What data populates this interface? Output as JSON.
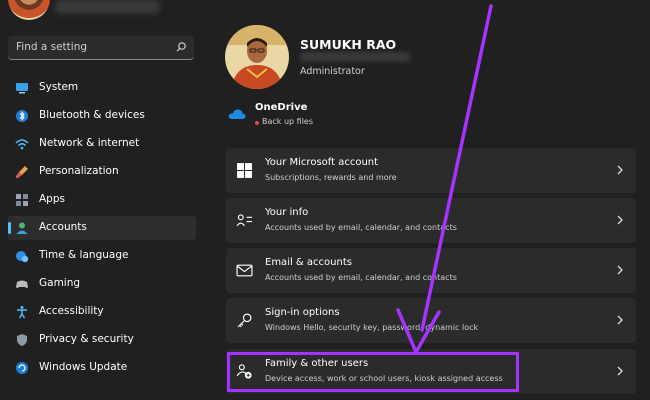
{
  "sidebar": {
    "search_placeholder": "Find a setting",
    "items": [
      {
        "label": "System",
        "icon": "monitor-icon"
      },
      {
        "label": "Bluetooth & devices",
        "icon": "bluetooth-icon"
      },
      {
        "label": "Network & internet",
        "icon": "wifi-icon"
      },
      {
        "label": "Personalization",
        "icon": "paintbrush-icon"
      },
      {
        "label": "Apps",
        "icon": "apps-icon"
      },
      {
        "label": "Accounts",
        "icon": "person-icon",
        "active": true
      },
      {
        "label": "Time & language",
        "icon": "globe-clock-icon"
      },
      {
        "label": "Gaming",
        "icon": "gamepad-icon"
      },
      {
        "label": "Accessibility",
        "icon": "accessibility-icon"
      },
      {
        "label": "Privacy & security",
        "icon": "shield-icon"
      },
      {
        "label": "Windows Update",
        "icon": "update-icon"
      }
    ]
  },
  "profile": {
    "name": "SUMUKH RAO",
    "role": "Administrator"
  },
  "onedrive": {
    "title": "OneDrive",
    "status": "Back up files"
  },
  "cards": [
    {
      "title": "Your Microsoft account",
      "subtitle": "Subscriptions, rewards and more",
      "icon": "windows-logo-icon"
    },
    {
      "title": "Your info",
      "subtitle": "Accounts used by email, calendar, and contacts",
      "icon": "contact-card-icon"
    },
    {
      "title": "Email & accounts",
      "subtitle": "Accounts used by email, calendar, and contacts",
      "icon": "envelope-icon"
    },
    {
      "title": "Sign-in options",
      "subtitle": "Windows Hello, security key, password, dynamic lock",
      "icon": "key-icon"
    },
    {
      "title": "Family & other users",
      "subtitle": "Device access, work or school users, kiosk assigned access",
      "icon": "family-icon"
    }
  ],
  "colors": {
    "background": "#202020",
    "card": "#2b2b2b",
    "accent": "#4cc2ff",
    "highlight": "#a533ff"
  }
}
